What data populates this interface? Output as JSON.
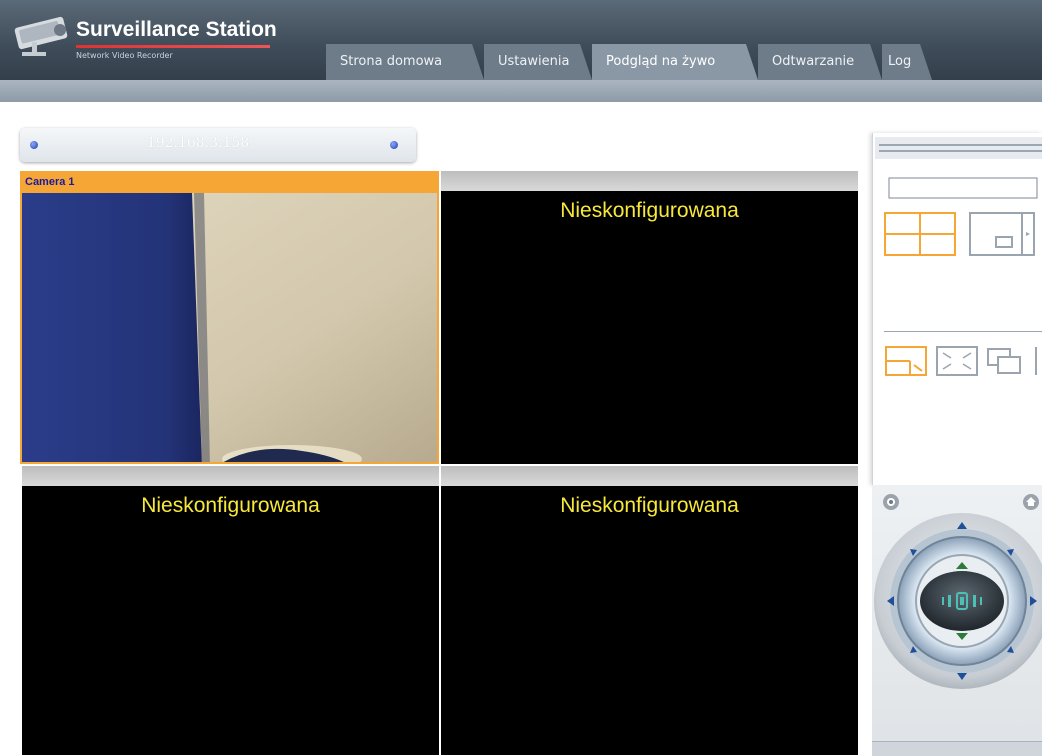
{
  "app": {
    "title": "Surveillance Station",
    "subtitle": "Network Video Recorder"
  },
  "tabs": [
    {
      "label": "Strona domowa",
      "active": false
    },
    {
      "label": "Ustawienia",
      "active": false
    },
    {
      "label": "Podgląd na żywo",
      "active": true
    },
    {
      "label": "Odtwarzanie",
      "active": false
    },
    {
      "label": "Log",
      "active": false
    }
  ],
  "server": {
    "ip": "192.168.3.158"
  },
  "cameras": [
    {
      "label": "Camera 1",
      "status": "",
      "selected": true
    },
    {
      "label": "",
      "status": "Nieskonfigurowana",
      "selected": false
    },
    {
      "label": "",
      "status": "Nieskonfigurowana",
      "selected": false
    },
    {
      "label": "",
      "status": "Nieskonfigurowana",
      "selected": false
    }
  ],
  "colors": {
    "accent": "#f6a634",
    "unconfigured_text": "#f7e83a",
    "camera_label": "#1a1aa0",
    "header": "#3e4b58"
  },
  "icons": {
    "layout": [
      "quad-layout-icon",
      "single-layout-icon"
    ],
    "view": [
      "zoom-icon",
      "fullscreen-icon",
      "pip-icon"
    ],
    "ptz": [
      "snapshot-icon",
      "home-icon",
      "ptz-up-icon",
      "ptz-down-icon",
      "ptz-left-icon",
      "ptz-right-icon",
      "zoom-in-icon",
      "zoom-out-icon",
      "ptz-center-icon"
    ]
  }
}
